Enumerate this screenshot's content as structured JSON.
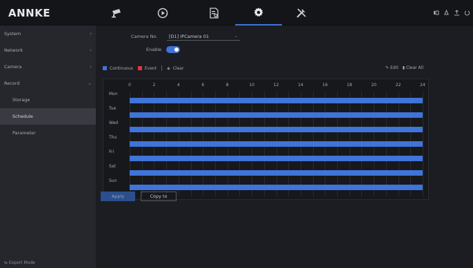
{
  "app": {
    "logo": "ANNKE"
  },
  "nav": {
    "items": [
      {
        "name": "live-view",
        "icon": "camera-icon"
      },
      {
        "name": "playback",
        "icon": "playback-icon"
      },
      {
        "name": "search",
        "icon": "file-search-icon"
      },
      {
        "name": "configuration",
        "icon": "gear-icon",
        "active": true
      },
      {
        "name": "maintenance",
        "icon": "tools-icon"
      }
    ]
  },
  "sidebar": {
    "items": [
      {
        "label": "System"
      },
      {
        "label": "Network"
      },
      {
        "label": "Camera"
      },
      {
        "label": "Record"
      }
    ],
    "sub_items": [
      {
        "label": "Storage"
      },
      {
        "label": "Schedule",
        "active": true
      },
      {
        "label": "Parameter"
      }
    ],
    "export_mode": "⇆ Export Mode"
  },
  "form": {
    "camera_label": "Camera No.",
    "camera_value": "[D1] IPCamera 01",
    "enable_label": "Enable",
    "enable_on": true
  },
  "legend": {
    "continuous": "Continuous",
    "event": "Event",
    "clear": "Clear",
    "edit": "Edit",
    "clear_all": "Clear All",
    "continuous_color": "#3f74d8",
    "event_color": "#d93a3a"
  },
  "schedule": {
    "hours": [
      "0",
      "2",
      "4",
      "6",
      "8",
      "10",
      "12",
      "14",
      "16",
      "18",
      "20",
      "22",
      "24"
    ],
    "days": [
      {
        "label": "Mon",
        "start": 0,
        "end": 24,
        "type": "continuous"
      },
      {
        "label": "Tue",
        "start": 0,
        "end": 24,
        "type": "continuous"
      },
      {
        "label": "Wed",
        "start": 0,
        "end": 24,
        "type": "continuous"
      },
      {
        "label": "Thu",
        "start": 0,
        "end": 24,
        "type": "continuous"
      },
      {
        "label": "Fri",
        "start": 0,
        "end": 24,
        "type": "continuous"
      },
      {
        "label": "Sat",
        "start": 0,
        "end": 24,
        "type": "continuous"
      },
      {
        "label": "Sun",
        "start": 0,
        "end": 24,
        "type": "continuous"
      }
    ]
  },
  "buttons": {
    "apply": "Apply",
    "copy_to": "Copy to"
  }
}
